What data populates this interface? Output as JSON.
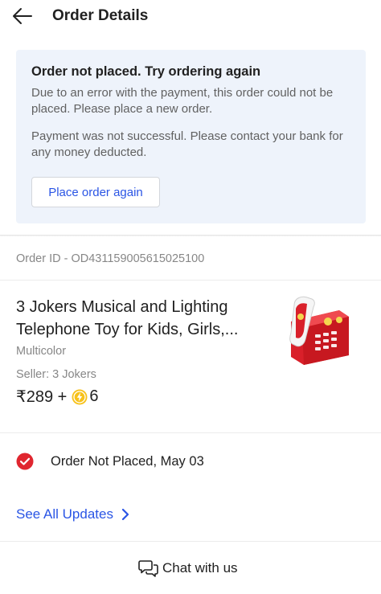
{
  "header": {
    "title": "Order Details",
    "back_icon": "arrow-left-icon"
  },
  "error_panel": {
    "title": "Order not placed. Try ordering again",
    "message": "Due to an error with the payment, this order could not be placed. Please place a new order.",
    "payment_note": "Payment was not successful. Please contact your bank for any money deducted.",
    "button_label": "Place order again"
  },
  "order": {
    "id_text": "Order ID - OD431159005615025100"
  },
  "product": {
    "name": "3 Jokers Musical and Lighting Telephone Toy for Kids, Girls,...",
    "color": "Multicolor",
    "seller": "Seller: 3 Jokers",
    "price": "₹289 +",
    "coins": "6",
    "image_alt": "Red toy telephone",
    "coin_icon": "supercoin-icon"
  },
  "status": {
    "icon": "check-circle-icon",
    "text": "Order Not Placed, May 03"
  },
  "updates": {
    "label": "See All Updates",
    "icon": "chevron-right-icon"
  },
  "chat": {
    "label": "Chat with us",
    "icon": "chat-bubbles-icon"
  },
  "colors": {
    "accent_blue": "#2a55e5",
    "error_panel_bg": "#eef3fb",
    "status_red": "#e0262f",
    "coin_yellow": "#f7c21b"
  }
}
